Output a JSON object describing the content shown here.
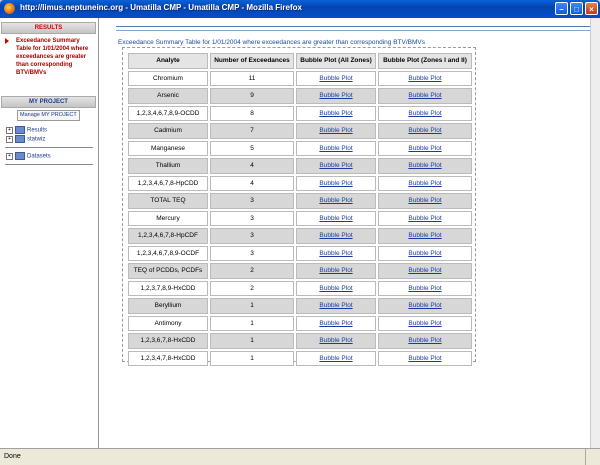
{
  "window": {
    "title": "http://limus.neptuneinc.org - Umatilla CMP - Umatilla CMP - Mozilla Firefox",
    "minimize_icon": "minimize-icon",
    "maximize_icon": "maximize-icon",
    "close_icon": "close-icon"
  },
  "sidebar": {
    "results_header": "RESULTS",
    "results_link": "Exceedance Summary Table for 1/01/2004 where exceedances are greater than corresponding BTV/BMVs",
    "project_header": "MY PROJECT",
    "manage_button": "Manage MY PROJECT",
    "tree": [
      {
        "label": "Results"
      },
      {
        "label": "statwiz"
      },
      {
        "label": "Datasets"
      }
    ]
  },
  "main": {
    "caption": "Exceedance Summary Table for 1/01/2004 where exceedances are greater than corresponding BTV/BMVs",
    "columns": [
      "Analyte",
      "Number of Exceedances",
      "Bubble Plot (All Zones)",
      "Bubble Plot (Zones I and II)"
    ],
    "link_label": "Bubble Plot",
    "rows": [
      {
        "analyte": "Chromium",
        "count": "11"
      },
      {
        "analyte": "Arsenic",
        "count": "9"
      },
      {
        "analyte": "1,2,3,4,6,7,8,9-OCDD",
        "count": "8"
      },
      {
        "analyte": "Cadmium",
        "count": "7"
      },
      {
        "analyte": "Manganese",
        "count": "5"
      },
      {
        "analyte": "Thallium",
        "count": "4"
      },
      {
        "analyte": "1,2,3,4,6,7,8-HpCDD",
        "count": "4"
      },
      {
        "analyte": "TOTAL TEQ",
        "count": "3"
      },
      {
        "analyte": "Mercury",
        "count": "3"
      },
      {
        "analyte": "1,2,3,4,6,7,8-HpCDF",
        "count": "3"
      },
      {
        "analyte": "1,2,3,4,6,7,8,9-OCDF",
        "count": "3"
      },
      {
        "analyte": "TEQ of PCDDs, PCDFs",
        "count": "2"
      },
      {
        "analyte": "1,2,3,7,8,9-HxCDD",
        "count": "2"
      },
      {
        "analyte": "Beryllium",
        "count": "1"
      },
      {
        "analyte": "Antimony",
        "count": "1"
      },
      {
        "analyte": "1,2,3,6,7,8-HxCDD",
        "count": "1"
      },
      {
        "analyte": "1,2,3,4,7,8-HxCDD",
        "count": "1"
      }
    ]
  },
  "status": {
    "text": "Done"
  },
  "colors": {
    "titlebar": "#0444b4",
    "header_red": "#cc0000",
    "link_blue": "#1a3aa0",
    "row_shade": "#d7d7d7",
    "rule_blue": "#5a7ab8"
  }
}
